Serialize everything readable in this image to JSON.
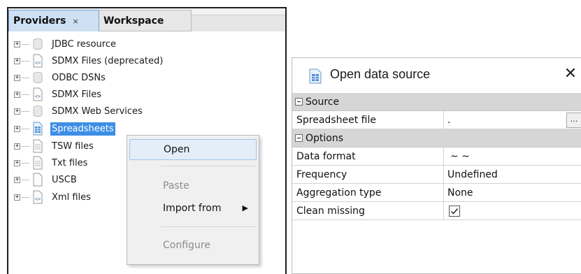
{
  "providers_panel": {
    "tabs": [
      {
        "label": "Providers",
        "close_glyph": "×",
        "active": true
      },
      {
        "label": "Workspace",
        "active": false
      }
    ],
    "tree": [
      {
        "label": "JDBC resource",
        "icon": "database-icon",
        "expander": "+"
      },
      {
        "label": "SDMX Files (deprecated)",
        "icon": "xml-file-icon",
        "expander": "+"
      },
      {
        "label": "ODBC DSNs",
        "icon": "database-icon",
        "expander": "+"
      },
      {
        "label": "SDMX Files",
        "icon": "xml-file-icon",
        "expander": "+"
      },
      {
        "label": "SDMX Web Services",
        "icon": "database-icon",
        "expander": "+"
      },
      {
        "label": "Spreadsheets",
        "icon": "spreadsheet-icon",
        "expander": "+",
        "selected": true
      },
      {
        "label": "TSW files",
        "icon": "text-file-icon",
        "expander": "+"
      },
      {
        "label": "Txt files",
        "icon": "text-file-icon",
        "expander": "+"
      },
      {
        "label": "USCB",
        "icon": "blank-file-icon",
        "expander": "+"
      },
      {
        "label": "Xml files",
        "icon": "xml-file-icon",
        "expander": "+"
      }
    ]
  },
  "context_menu": {
    "open": "Open",
    "paste": "Paste",
    "import_from": "Import from",
    "submenu_arrow": "▶",
    "configure": "Configure"
  },
  "dialog": {
    "title": "Open data source",
    "close_glyph": "✕",
    "categories": {
      "source": {
        "label": "Source",
        "properties": {
          "spreadsheet_file": {
            "name": "Spreadsheet file",
            "value": ".",
            "browse_label": "..."
          }
        }
      },
      "options": {
        "label": "Options",
        "properties": {
          "data_format": {
            "name": "Data format",
            "value": "~ ~"
          },
          "frequency": {
            "name": "Frequency",
            "value": "Undefined"
          },
          "aggregation_type": {
            "name": "Aggregation type",
            "value": "None"
          },
          "clean_missing": {
            "name": "Clean missing",
            "checked": true
          }
        }
      }
    }
  },
  "colors": {
    "selection": "#3d8ee6",
    "active_tab": "#cfe0f4",
    "category_row": "#d6d6d6",
    "menu_hover": "#e4eef9"
  }
}
